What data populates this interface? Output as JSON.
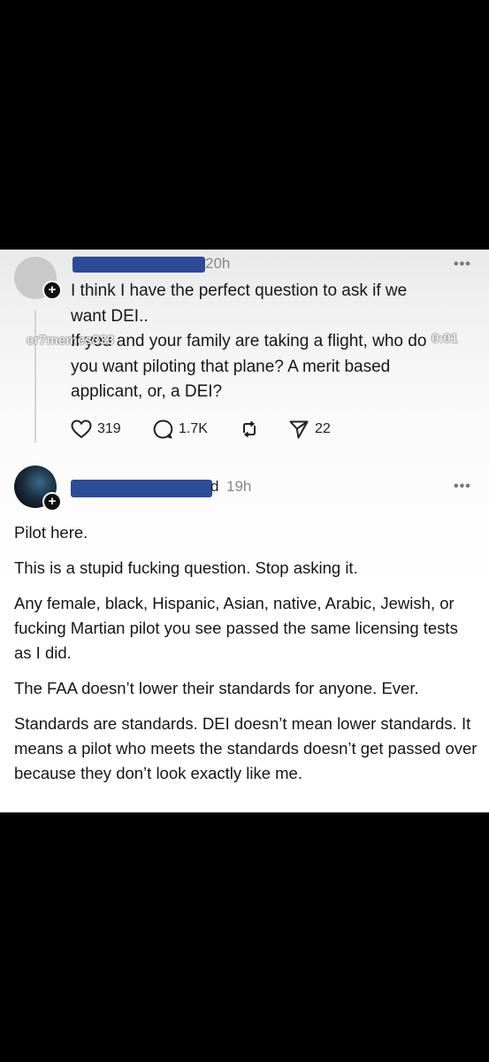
{
  "watermark": {
    "left": "cr7memes333",
    "right": "0:01"
  },
  "post1": {
    "time": "20h",
    "more": "•••",
    "lines": [
      "I think I have the perfect question to ask if we",
      "want DEI..",
      "If you and your family are taking a flight, who do",
      "you want piloting that plane? A merit based",
      "applicant, or, a DEI?"
    ],
    "actions": {
      "likes": "319",
      "replies": "1.7K",
      "shares": "22"
    }
  },
  "post2": {
    "time_prefix": "d",
    "time": "19h",
    "more": "•••",
    "paragraphs": [
      "Pilot here.",
      "This is a stupid fucking question.  Stop asking it.",
      "Any female, black, Hispanic, Asian, native, Arabic, Jewish, or fucking Martian pilot you see passed the same licensing tests as I did.",
      "The FAA doesn’t lower their standards for anyone.  Ever.",
      "Standards are standards.  DEI doesn’t mean lower standards.  It means a pilot who meets the standards doesn’t get passed over because they don’t look exactly like me."
    ]
  }
}
